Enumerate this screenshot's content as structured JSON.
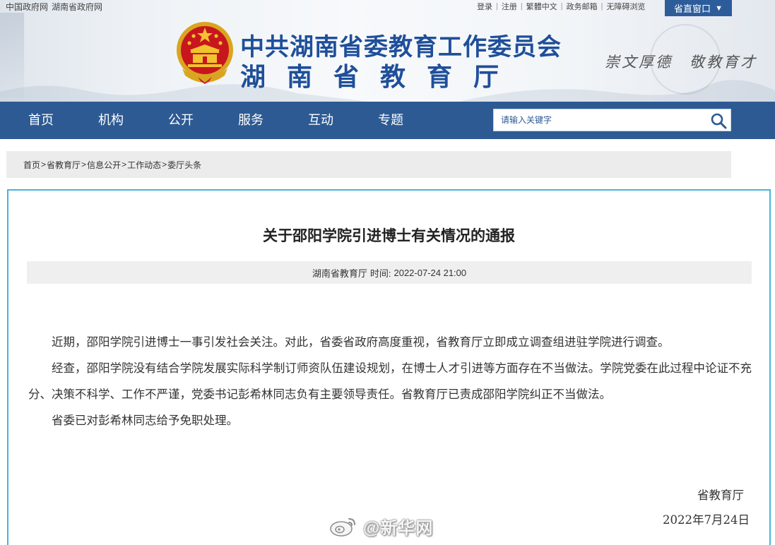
{
  "header": {
    "top_links": [
      "中国政府网",
      "湖南省政府网"
    ],
    "util_links": [
      "登录",
      "注册",
      "繁體中文",
      "政务邮箱",
      "无障碍浏览"
    ],
    "direct_window": "省直窗口",
    "title_main": "中共湖南省委教育工作委员会",
    "title_sub": "湖南省教育厅",
    "motto": "崇文厚德　敬教育才"
  },
  "nav": {
    "items": [
      "首页",
      "机构",
      "公开",
      "服务",
      "互动",
      "专题"
    ],
    "search_placeholder": "请输入关键字"
  },
  "breadcrumb": [
    "首页",
    "省教育厅",
    "信息公开",
    "工作动态",
    "委厅头条"
  ],
  "article": {
    "title": "关于邵阳学院引进博士有关情况的通报",
    "source": "湖南省教育厅",
    "time_label": "时间:",
    "time": "2022-07-24 21:00",
    "paragraphs": [
      "近期，邵阳学院引进博士一事引发社会关注。对此，省委省政府高度重视，省教育厅立即成立调查组进驻学院进行调查。",
      "经查，邵阳学院没有结合学院发展实际科学制订师资队伍建设规划，在博士人才引进等方面存在不当做法。学院党委在此过程中论证不充分、决策不科学、工作不严谨，党委书记彭希林同志负有主要领导责任。省教育厅已责成邵阳学院纠正不当做法。",
      "省委已对彭希林同志给予免职处理。"
    ],
    "sign_org": "省教育厅",
    "sign_date": "2022年7月24日"
  },
  "watermark": "@新华网",
  "colors": {
    "nav_bg": "#2d5a93",
    "title_blue": "#1f4f9a",
    "article_border": "#49b3d8"
  }
}
